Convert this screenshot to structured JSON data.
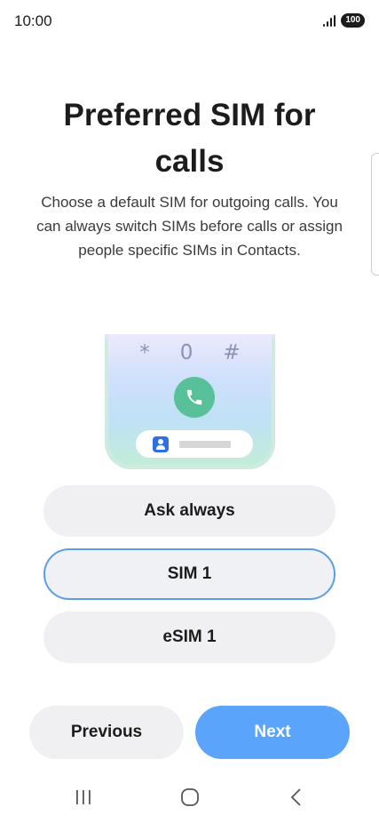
{
  "status_bar": {
    "time": "10:00",
    "battery": "100",
    "icons": [
      "signal-icon",
      "battery-icon"
    ]
  },
  "page": {
    "title": "Preferred SIM for calls",
    "description": "Choose a default SIM for outgoing calls. You can always switch SIMs before calls or assign people specific SIMs in Contacts."
  },
  "illustration": {
    "keypad": [
      "*",
      "0",
      "#"
    ],
    "icons": [
      "phone-call-icon",
      "contact-icon"
    ],
    "colors": {
      "call_button": "#58c19a",
      "contact_icon": "#2f6fe4"
    }
  },
  "options": {
    "selected": "SIM 1",
    "items": [
      {
        "label": "Ask always"
      },
      {
        "label": "SIM 1"
      },
      {
        "label": "eSIM 1"
      }
    ]
  },
  "footer": {
    "previous_label": "Previous",
    "next_label": "Next",
    "accent_color": "#5aa5fb"
  },
  "nav_bar": {
    "icons": [
      "recent-apps-icon",
      "home-icon",
      "back-icon"
    ]
  }
}
